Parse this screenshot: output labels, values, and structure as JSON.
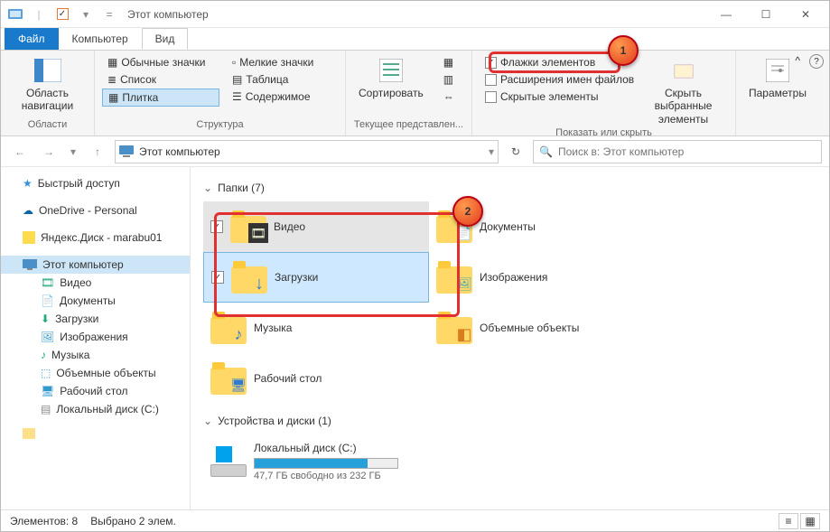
{
  "title": "Этот компьютер",
  "tabs": {
    "file": "Файл",
    "computer": "Компьютер",
    "view": "Вид"
  },
  "ribbon": {
    "panes": {
      "label": "Область навигации",
      "drop": "▾",
      "group": "Области"
    },
    "layout": {
      "items": [
        "Обычные значки",
        "Мелкие значки",
        "Список",
        "Таблица",
        "Плитка",
        "Содержимое"
      ],
      "group": "Структура"
    },
    "current": {
      "sort": "Сортировать",
      "group": "Текущее представлен..."
    },
    "show": {
      "itemcheck": "Флажки элементов",
      "ext": "Расширения имен файлов",
      "hidden": "Скрытые элементы",
      "hide": "Скрыть выбранные элементы",
      "group": "Показать или скрыть"
    },
    "options": "Параметры"
  },
  "address": {
    "loc": "Этот компьютер"
  },
  "search": {
    "placeholder": "Поиск в: Этот компьютер"
  },
  "tree": {
    "quick": "Быстрый доступ",
    "onedrive": "OneDrive - Personal",
    "yadisk": "Яндекс.Диск - marabu01",
    "thispc": "Этот компьютер",
    "items": [
      "Видео",
      "Документы",
      "Загрузки",
      "Изображения",
      "Музыка",
      "Объемные объекты",
      "Рабочий стол",
      "Локальный диск (C:)"
    ]
  },
  "content": {
    "foldershdr": "Папки (7)",
    "folders": [
      {
        "name": "Видео"
      },
      {
        "name": "Документы"
      },
      {
        "name": "Загрузки"
      },
      {
        "name": "Изображения"
      },
      {
        "name": "Музыка"
      },
      {
        "name": "Объемные объекты"
      },
      {
        "name": "Рабочий стол"
      }
    ],
    "driveshdr": "Устройства и диски (1)",
    "drive": {
      "name": "Локальный диск (C:)",
      "free": "47,7 ГБ свободно из 232 ГБ",
      "pct": 79
    }
  },
  "status": {
    "count": "Элементов: 8",
    "sel": "Выбрано 2 элем."
  },
  "badges": {
    "b1": "1",
    "b2": "2"
  }
}
